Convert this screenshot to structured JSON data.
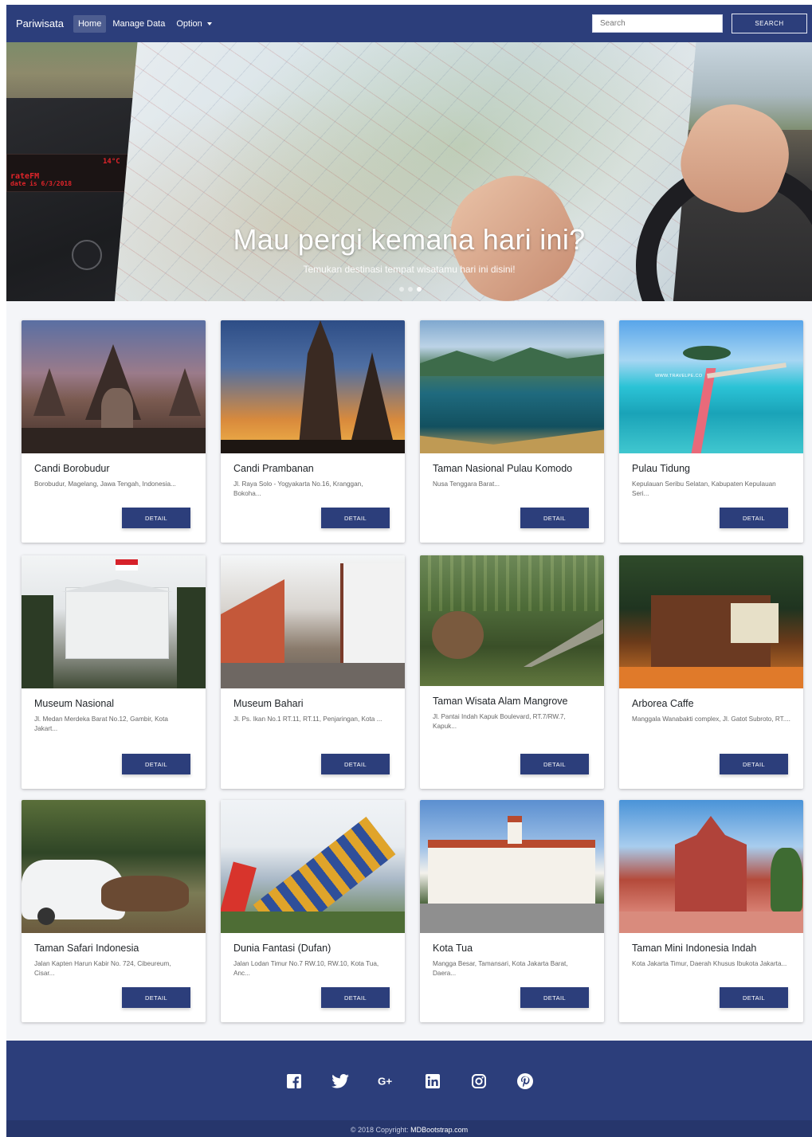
{
  "navbar": {
    "brand": "Pariwisata",
    "items": [
      {
        "label": "Home",
        "active": true
      },
      {
        "label": "Manage Data",
        "active": false
      },
      {
        "label": "Option",
        "active": false
      }
    ],
    "search_placeholder": "Search",
    "search_button": "SEARCH"
  },
  "hero": {
    "title": "Mau pergi kemana hari ini?",
    "subtitle": "Temukan destinasi tempat wisatamu hari ini disini!",
    "radio_brand": "rateFM",
    "radio_date": "date is 6/3/2018",
    "radio_freq": "14°C",
    "slides": 3,
    "active_slide": 3
  },
  "cards": [
    {
      "title": "Candi Borobudur",
      "text": "Borobudur, Magelang, Jawa Tengah, Indonesia...",
      "button": "DETAIL",
      "scene": "borobudur"
    },
    {
      "title": "Candi Prambanan",
      "text": "Jl. Raya Solo - Yogyakarta No.16, Kranggan, Bokoha...",
      "button": "DETAIL",
      "scene": "prambanan"
    },
    {
      "title": "Taman Nasional Pulau Komodo",
      "text": "Nusa Tenggara Barat...",
      "button": "DETAIL",
      "scene": "komodo"
    },
    {
      "title": "Pulau Tidung",
      "text": "Kepulauan Seribu Selatan, Kabupaten Kepulauan Seri...",
      "button": "DETAIL",
      "scene": "tidung",
      "image_label": "WWW.TRAVELPE.CO"
    },
    {
      "title": "Museum Nasional",
      "text": "Jl. Medan Merdeka Barat No.12, Gambir, Kota Jakart...",
      "button": "DETAIL",
      "scene": "museum"
    },
    {
      "title": "Museum Bahari",
      "text": "Jl. Ps. Ikan No.1 RT.11, RT.11, Penjaringan, Kota ...",
      "button": "DETAIL",
      "scene": "bahari"
    },
    {
      "title": "Taman Wisata Alam Mangrove",
      "text": "Jl. Pantai Indah Kapuk Boulevard, RT.7/RW.7, Kapuk...",
      "button": "DETAIL",
      "scene": "mangrove"
    },
    {
      "title": "Arborea Caffe",
      "text": "Manggala Wanabakti complex, Jl. Gatot Subroto, RT....",
      "button": "DETAIL",
      "scene": "arborea"
    },
    {
      "title": "Taman Safari Indonesia",
      "text": "Jalan Kapten Harun Kabir No. 724, Cibeureum, Cisar...",
      "button": "DETAIL",
      "scene": "safari"
    },
    {
      "title": "Dunia Fantasi (Dufan)",
      "text": "Jalan Lodan Timur No.7 RW.10, RW.10, Kota Tua, Anc...",
      "button": "DETAIL",
      "scene": "dufan"
    },
    {
      "title": "Kota Tua",
      "text": "Mangga Besar, Tamansari, Kota Jakarta Barat, Daera...",
      "button": "DETAIL",
      "scene": "kotatua"
    },
    {
      "title": "Taman Mini Indonesia Indah",
      "text": "Kota Jakarta Timur, Daerah Khusus Ibukota Jakarta...",
      "button": "DETAIL",
      "scene": "tmii"
    }
  ],
  "footer": {
    "icons": [
      "facebook-icon",
      "twitter-icon",
      "google-plus-icon",
      "linkedin-icon",
      "instagram-icon",
      "pinterest-icon"
    ],
    "copyright_prefix": "© 2018 Copyright:",
    "copyright_link": "MDBootstrap.com"
  },
  "colors": {
    "primary": "#2c3e7b",
    "background": "#f4f5f8"
  }
}
